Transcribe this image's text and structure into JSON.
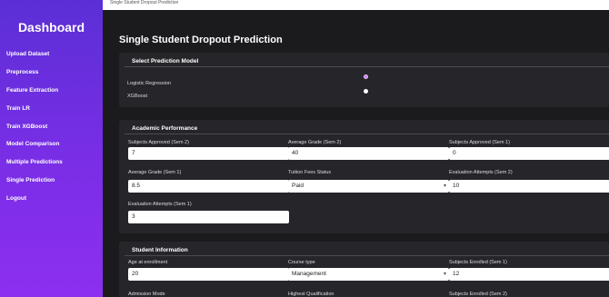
{
  "sidebar": {
    "title": "Dashboard",
    "items": [
      {
        "label": "Upload Dataset",
        "name": "sidebar-item-upload-dataset"
      },
      {
        "label": "Preprocess",
        "name": "sidebar-item-preprocess"
      },
      {
        "label": "Feature Extraction",
        "name": "sidebar-item-feature-extraction"
      },
      {
        "label": "Train LR",
        "name": "sidebar-item-train-lr"
      },
      {
        "label": "Train XGBoost",
        "name": "sidebar-item-train-xgboost"
      },
      {
        "label": "Model Comparison",
        "name": "sidebar-item-model-comparison"
      },
      {
        "label": "Multiple Predictions",
        "name": "sidebar-item-multiple-predictions"
      },
      {
        "label": "Single Prediction",
        "name": "sidebar-item-single-prediction"
      },
      {
        "label": "Logout",
        "name": "sidebar-item-logout"
      }
    ]
  },
  "topbar": {
    "text": "Single Student Dropout Prediction"
  },
  "page": {
    "title": "Single Student Dropout Prediction"
  },
  "model_section": {
    "title": "Select Prediction Model",
    "options": [
      {
        "label": "Logistic Regression",
        "checked": true
      },
      {
        "label": "XGBoost",
        "checked": false
      }
    ]
  },
  "academic": {
    "title": "Academic Performance",
    "fields": [
      {
        "label": "Subjects Approved (Sem 2)",
        "value": "7",
        "type": "input"
      },
      {
        "label": "Average Grade (Sem 2)",
        "value": "40",
        "type": "input"
      },
      {
        "label": "Subjects Approved (Sem 1)",
        "value": "0",
        "type": "input"
      },
      {
        "label": "Average Grade (Sem 1)",
        "value": "8.5",
        "type": "input"
      },
      {
        "label": "Tuition Fees Status",
        "value": "Paid",
        "type": "select"
      },
      {
        "label": "Evaluation Attempts (Sem 2)",
        "value": "10",
        "type": "input"
      },
      {
        "label": "Evaluation Attempts (Sem 1)",
        "value": "3",
        "type": "input"
      }
    ]
  },
  "student": {
    "title": "Student Information",
    "fields": [
      {
        "label": "Age at enrollment",
        "value": "20",
        "type": "input"
      },
      {
        "label": "Course type",
        "value": "Management",
        "type": "select"
      },
      {
        "label": "Subjects Enrolled (Sem 1)",
        "value": "12",
        "type": "input"
      }
    ],
    "more_labels": [
      "Admission Mode",
      "Highest Qualification",
      "Subjects Enrolled (Sem 2)"
    ]
  },
  "colors": {
    "sidebar_top": "#5b2fd6",
    "sidebar_bottom": "#8d2ff0",
    "main_bg": "#1b1b1d",
    "card_bg": "#26262a",
    "radio_checked": "#c57ff0"
  },
  "icons": {
    "select_chevron": "chevron-down-icon"
  }
}
